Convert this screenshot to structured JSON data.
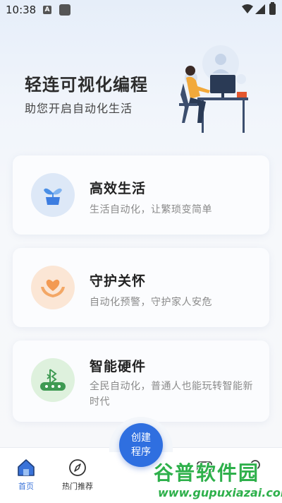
{
  "status_bar": {
    "time": "10:38",
    "notification_icon": "A"
  },
  "hero": {
    "title": "轻连可视化编程",
    "subtitle": "助您开启自动化生活"
  },
  "cards": [
    {
      "title": "高效生活",
      "description": "生活自动化，让繁琐变简单",
      "icon": "plant-icon"
    },
    {
      "title": "守护关怀",
      "description": "自动化预警，守护家人安危",
      "icon": "heart-hands-icon"
    },
    {
      "title": "智能硬件",
      "description": "全民自动化，普通人也能玩转智能新时代",
      "icon": "bluetooth-device-icon"
    }
  ],
  "bottom_nav": {
    "items": [
      {
        "label": "首页",
        "icon": "home-icon",
        "active": true
      },
      {
        "label": "热门推荐",
        "icon": "compass-icon",
        "active": false
      }
    ],
    "create_button": {
      "line1": "创建",
      "line2": "程序"
    }
  },
  "watermark": {
    "main": "谷普软件园",
    "url": "www.gupuxiazai.com"
  },
  "colors": {
    "accent": "#2f6fe0",
    "active_nav": "#3a73d9",
    "watermark": "#2eb04b"
  }
}
